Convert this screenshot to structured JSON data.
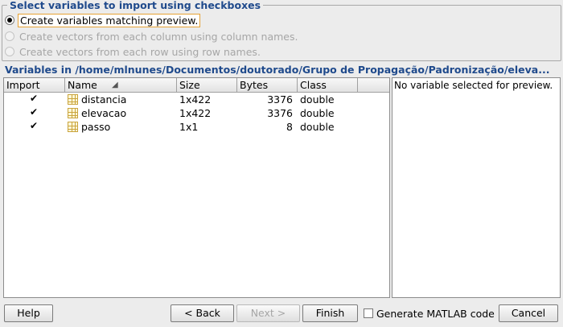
{
  "import_options": {
    "title": "Select variables to import using checkboxes",
    "options": [
      {
        "label": "Create variables matching preview.",
        "checked": true,
        "enabled": true
      },
      {
        "label": "Create vectors from each column using column names.",
        "checked": false,
        "enabled": false
      },
      {
        "label": "Create vectors from each row using row names.",
        "checked": false,
        "enabled": false
      }
    ]
  },
  "variables_section": {
    "title": "Variables in /home/mlnunes/Documentos/doutorado/Grupo de Propagação/Padronização/eleva..."
  },
  "table": {
    "columns": [
      "Import",
      "Name",
      "Size",
      "Bytes",
      "Class"
    ],
    "rows": [
      {
        "import": true,
        "name": "distancia",
        "size": "1x422",
        "bytes": "3376",
        "class": "double"
      },
      {
        "import": true,
        "name": "elevacao",
        "size": "1x422",
        "bytes": "3376",
        "class": "double"
      },
      {
        "import": true,
        "name": "passo",
        "size": "1x1",
        "bytes": "8",
        "class": "double"
      }
    ],
    "sort_icon": "sort-ascending-icon"
  },
  "preview": {
    "text": "No variable selected for preview."
  },
  "footer": {
    "help_label": "Help",
    "back_label": "< Back",
    "next_label": "Next >",
    "finish_label": "Finish",
    "generate_code_label": "Generate MATLAB code",
    "generate_code_checked": false,
    "cancel_label": "Cancel"
  }
}
